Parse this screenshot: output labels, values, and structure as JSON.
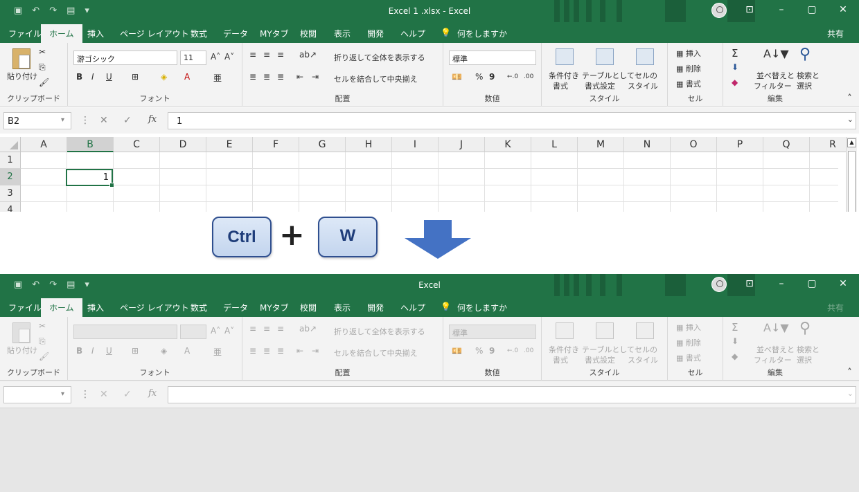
{
  "top": {
    "title": "Excel 1 .xlsx  -  Excel",
    "name_box": "B2",
    "formula_value": "1",
    "active_cell_value": "1",
    "active_column": "B",
    "active_row": "2"
  },
  "bottom": {
    "title": "Excel",
    "name_box": "",
    "formula_value": ""
  },
  "window": {
    "minimize": "–",
    "restore": "▢",
    "close": "✕",
    "ribbon_display": "⊡"
  },
  "quick_access": [
    "▣",
    "↶",
    "↷",
    "▤",
    "▾"
  ],
  "tabs": [
    "ファイル",
    "ホーム",
    "挿入",
    "ページ レイアウト",
    "数式",
    "データ",
    "MYタブ",
    "校閲",
    "表示",
    "開発",
    "ヘルプ"
  ],
  "tell_me": "何をしますか",
  "share": "共有",
  "ribbon": {
    "clipboard": {
      "paste": "貼り付け",
      "label": "クリップボード"
    },
    "font": {
      "name": "游ゴシック",
      "size": "11",
      "bold": "B",
      "italic": "I",
      "underline": "U",
      "label": "フォント"
    },
    "alignment": {
      "wrap": "折り返して全体を表示する",
      "merge": "セルを結合して中央揃え",
      "label": "配置"
    },
    "number": {
      "format": "標準",
      "percent": "%",
      "comma": "9",
      "label": "数値"
    },
    "styles": {
      "conditional_1": "条件付き",
      "conditional_2": "書式",
      "table_1": "テーブルとして",
      "table_2": "書式設定",
      "cell_1": "セルの",
      "cell_2": "スタイル",
      "label": "スタイル"
    },
    "cells": {
      "insert": "挿入",
      "delete": "削除",
      "format": "書式",
      "label": "セル"
    },
    "editing": {
      "sum": "Σ",
      "sort_1": "並べ替えと",
      "sort_2": "フィルター",
      "find_1": "検索と",
      "find_2": "選択",
      "label": "編集"
    }
  },
  "columns": [
    "A",
    "B",
    "C",
    "D",
    "E",
    "F",
    "G",
    "H",
    "I",
    "J",
    "K",
    "L",
    "M",
    "N",
    "O",
    "P",
    "Q",
    "R"
  ],
  "rows": [
    "1",
    "2",
    "3",
    "4"
  ],
  "shortcut": {
    "key1": "Ctrl",
    "plus": "+",
    "key2": "W"
  },
  "colors": {
    "excel_green": "#217346",
    "key_blue": "#2f4f8f",
    "arrow_blue": "#4472c4"
  }
}
